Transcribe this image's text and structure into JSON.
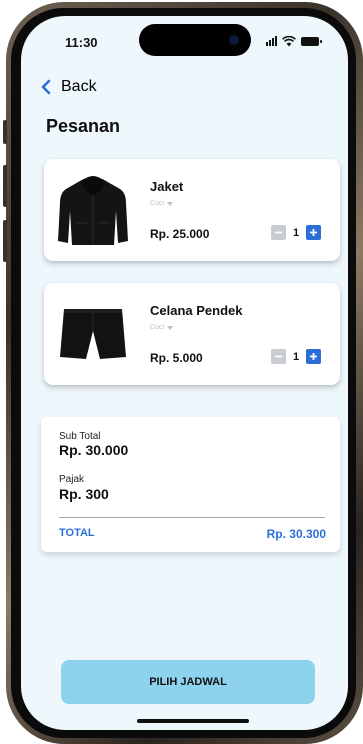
{
  "status_bar": {
    "time": "11:30"
  },
  "header": {
    "back_label": "Back",
    "title": "Pesanan"
  },
  "cart_items": [
    {
      "name": "Jaket",
      "category": "Cuci",
      "price": "Rp. 25.000",
      "quantity": "1",
      "image_icon": "jacket-image"
    },
    {
      "name": "Celana Pendek",
      "category": "Cuci",
      "price": "Rp. 5.000",
      "quantity": "1",
      "image_icon": "shorts-image"
    }
  ],
  "summary": {
    "subtotal_label": "Sub Total",
    "subtotal_value": "Rp. 30.000",
    "tax_label": "Pajak",
    "tax_value": "Rp. 300",
    "total_label": "TOTAL",
    "total_value": "Rp. 30.300"
  },
  "cta": {
    "label": "PILIH JADWAL"
  },
  "colors": {
    "accent": "#2b6fd6",
    "screen_bg": "#eef7fc",
    "cta_bg": "#8ed3ee"
  }
}
